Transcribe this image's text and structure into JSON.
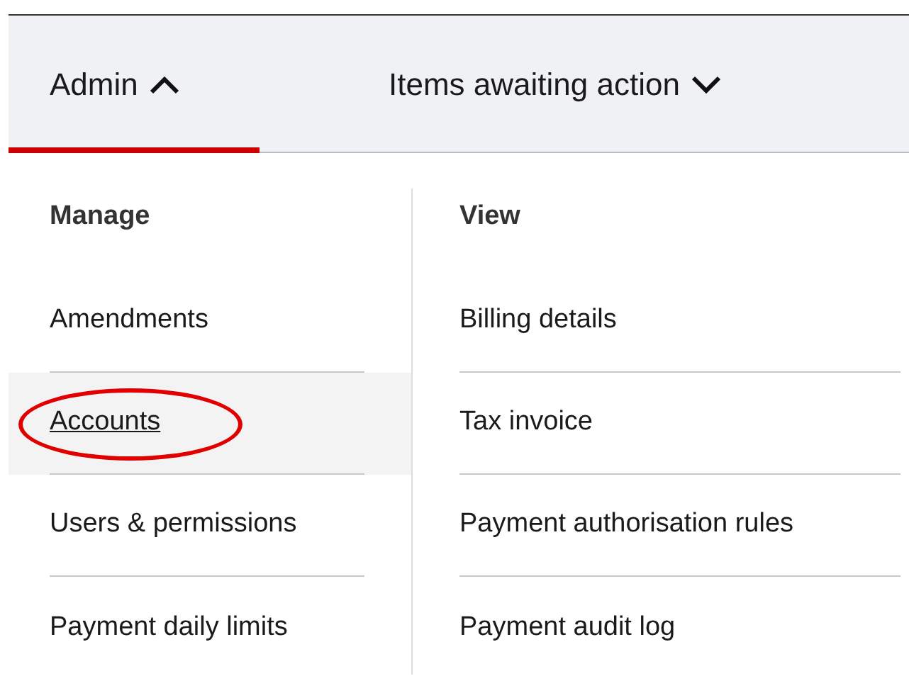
{
  "nav": [
    {
      "label": "Admin",
      "expanded": true,
      "selected": true
    },
    {
      "label": "Items awaiting action",
      "expanded": false,
      "selected": false
    }
  ],
  "menu": {
    "columns": [
      {
        "heading": "Manage",
        "items": [
          {
            "label": "Amendments",
            "hovered": false,
            "circled": false
          },
          {
            "label": "Accounts",
            "hovered": true,
            "circled": true
          },
          {
            "label": "Users & permissions",
            "hovered": false,
            "circled": false
          },
          {
            "label": "Payment daily limits",
            "hovered": false,
            "circled": false
          }
        ]
      },
      {
        "heading": "View",
        "items": [
          {
            "label": "Billing details",
            "hovered": false,
            "circled": false
          },
          {
            "label": "Tax invoice",
            "hovered": false,
            "circled": false
          },
          {
            "label": "Payment authorisation rules",
            "hovered": false,
            "circled": false
          },
          {
            "label": "Payment audit log",
            "hovered": false,
            "circled": false
          }
        ]
      }
    ]
  }
}
